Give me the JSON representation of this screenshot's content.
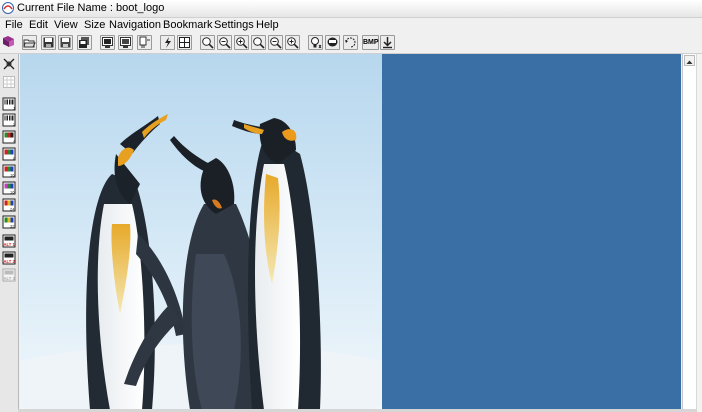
{
  "window": {
    "title": "Current File Name : boot_logo",
    "app_icon": "app-logo-icon"
  },
  "menu": [
    {
      "id": "file",
      "label": "File"
    },
    {
      "id": "edit",
      "label": "Edit"
    },
    {
      "id": "view",
      "label": "View"
    },
    {
      "id": "size",
      "label": "Size"
    },
    {
      "id": "navigation",
      "label": "Navigation"
    },
    {
      "id": "bookmark",
      "label": "Bookmark"
    },
    {
      "id": "settings",
      "label": "Settings"
    },
    {
      "id": "help",
      "label": "Help"
    }
  ],
  "toolbar": {
    "buttons": [
      {
        "name": "app-icon",
        "icon": "book-icon"
      },
      {
        "name": "open",
        "icon": "open-folder-icon"
      },
      {
        "name": "save",
        "icon": "save-icon"
      },
      {
        "name": "save-as",
        "icon": "save-as-icon"
      },
      {
        "name": "save-all",
        "icon": "save-all-icon"
      },
      {
        "name": "screen-1",
        "icon": "monitor-icon"
      },
      {
        "name": "screen-2",
        "icon": "monitor-icon"
      },
      {
        "name": "flash",
        "icon": "flash-icon"
      },
      {
        "name": "lightning",
        "icon": "lightning-icon"
      },
      {
        "name": "grid",
        "icon": "grid-icon"
      },
      {
        "name": "zoom-1",
        "icon": "zoom-icon"
      },
      {
        "name": "zoom-2",
        "icon": "zoom-icon"
      },
      {
        "name": "zoom-3",
        "icon": "zoom-icon"
      },
      {
        "name": "zoom-4",
        "icon": "zoom-icon"
      },
      {
        "name": "zoom-5",
        "icon": "zoom-icon"
      },
      {
        "name": "zoom-6",
        "icon": "zoom-icon"
      },
      {
        "name": "bulb",
        "icon": "bulb-icon"
      },
      {
        "name": "mask",
        "icon": "mask-icon"
      },
      {
        "name": "rotate",
        "icon": "rotate-icon"
      },
      {
        "name": "bmp",
        "icon": "bmp-icon",
        "label": "BMP"
      },
      {
        "name": "download",
        "icon": "download-icon"
      }
    ]
  },
  "sidebar": {
    "tools": [
      {
        "name": "crosshair",
        "icon": "crosshair-icon"
      },
      {
        "name": "grid",
        "icon": "grid-icon"
      },
      {
        "name": "mode-1",
        "icon": "mode-1-icon",
        "label": "1"
      },
      {
        "name": "mode-2",
        "icon": "mode-2-icon",
        "label": "2"
      },
      {
        "name": "mode-4",
        "icon": "mode-4-icon",
        "label": "4"
      },
      {
        "name": "mode-8",
        "icon": "mode-8-icon",
        "label": "8"
      },
      {
        "name": "mode-16",
        "icon": "mode-16-icon",
        "label": "16"
      },
      {
        "name": "mode-16b",
        "icon": "mode-16b-icon",
        "label": "16"
      },
      {
        "name": "mode-24",
        "icon": "mode-24-icon",
        "label": "24"
      },
      {
        "name": "mode-32",
        "icon": "mode-32-icon",
        "label": "32"
      },
      {
        "name": "alt-1",
        "icon": "alt-1-icon",
        "label": "ALT 1"
      },
      {
        "name": "alt-2",
        "icon": "alt-2-icon",
        "label": "ALT 2"
      },
      {
        "name": "alt-3",
        "icon": "alt-3-icon",
        "label": "ALT 3"
      }
    ]
  },
  "canvas": {
    "background_color": "#3a6fa6",
    "image": "penguins-icon"
  }
}
